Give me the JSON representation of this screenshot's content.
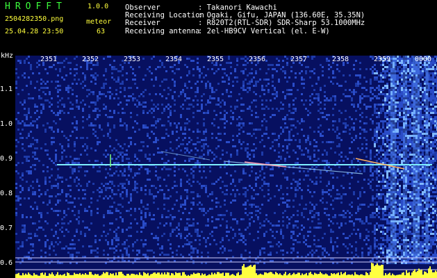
{
  "app": {
    "title": "HROFFT",
    "version": "1.0.0"
  },
  "file": {
    "name": "2504282350.png",
    "timestamp": "25.04.28 23:50"
  },
  "meteor": {
    "label": "meteor",
    "count": "63"
  },
  "info": [
    {
      "label": "Observer",
      "value": ": Takanori Kawachi"
    },
    {
      "label": "Receiving Location",
      "value": ": Ogaki, Gifu, JAPAN (136.60E, 35.35N)"
    },
    {
      "label": "Receiver",
      "value": ": R820T2(RTL-SDR) SDR-Sharp 53.1000MHz"
    },
    {
      "label": "Receiving antenna",
      "value": ": 2el-HB9CV Vertical (el. E-W)"
    }
  ],
  "axes": {
    "y_unit": "kHz",
    "y_ticks": [
      "1.1",
      "1.0",
      "0.9",
      "0.8",
      "0.7",
      "0.6"
    ],
    "x_ticks": [
      "2351",
      "2352",
      "2353",
      "2354",
      "2355",
      "2356",
      "2357",
      "2358",
      "2359",
      "0000"
    ]
  },
  "colors": {
    "label_green": "#3cff3c",
    "label_white": "#ffffff",
    "label_yellow": "#ffff3c",
    "noise_blue": "#1a2f9a",
    "carrier": "#7ff0ff"
  }
}
